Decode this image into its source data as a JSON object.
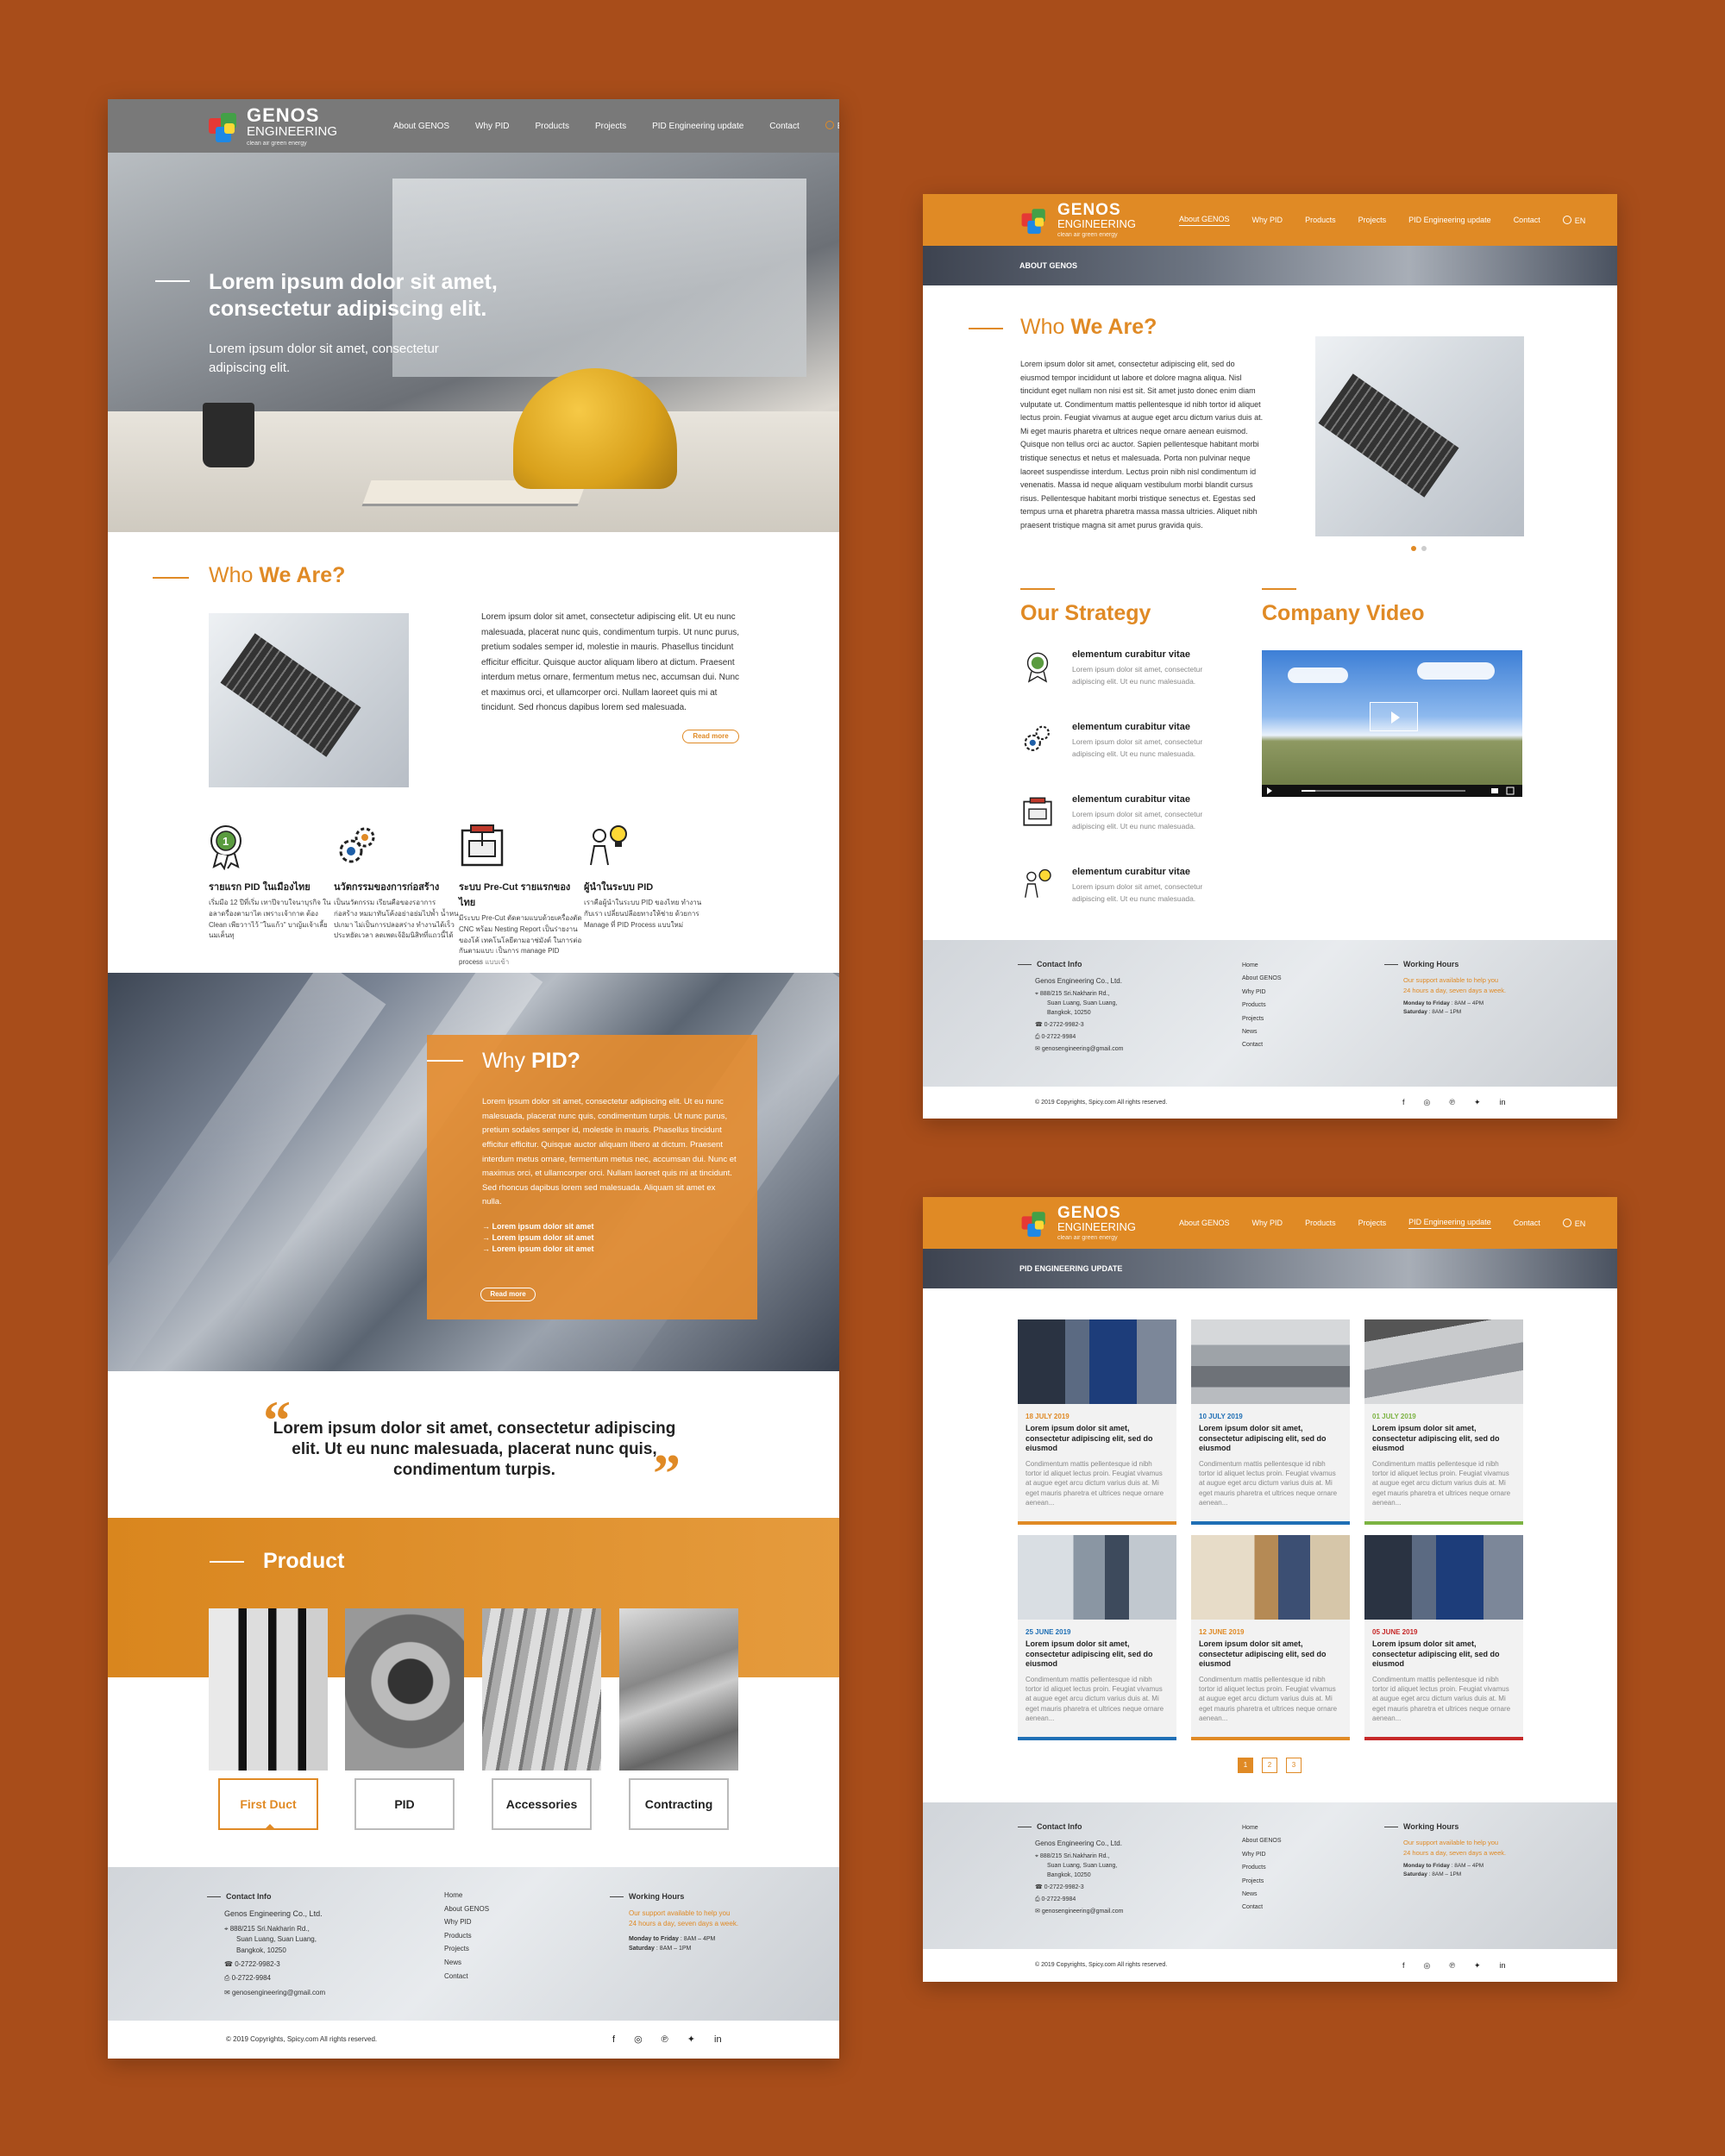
{
  "brand": {
    "name_line1": "GENOS",
    "name_line2": "ENGINEERING",
    "tagline": "clean air green energy",
    "colors": {
      "accent": "#e08a25",
      "background": "#a84d1a",
      "logo_red": "#e53935",
      "logo_green": "#43a047",
      "logo_blue": "#1e88e5",
      "logo_yellow": "#fdd835"
    }
  },
  "nav": {
    "items": [
      "About GENOS",
      "Why PID",
      "Products",
      "Projects",
      "PID Engineering update",
      "Contact"
    ],
    "language": "EN"
  },
  "home": {
    "hero": {
      "title": "Lorem ipsum dolor sit amet, consectetur adipiscing elit.",
      "subtitle": "Lorem ipsum dolor sit amet, consectetur adipiscing elit."
    },
    "who": {
      "title_prefix": "Who ",
      "title_bold": "We Are?",
      "body": "Lorem ipsum dolor sit amet, consectetur adipiscing elit. Ut eu nunc malesuada, placerat nunc quis, condimentum turpis. Ut nunc purus, pretium sodales semper id, molestie in mauris. Phasellus tincidunt efficitur efficitur. Quisque auctor aliquam libero at dictum. Praesent interdum metus ornare, fermentum metus nec, accumsan dui. Nunc et maximus orci, et ullamcorper orci. Nullam laoreet quis mi at tincidunt. Sed rhoncus dapibus lorem sed malesuada.",
      "read_more": "Read more"
    },
    "features": [
      {
        "icon": "award-ribbon-icon",
        "title": "รายแรก PID ในเมืองไทย",
        "text": "เริ่มมีอ 12 ปีที่เริ่ม เทาปีจาบใจนาบุรกิจ ในอลาดรื่องตามาไต เพราะเจ้ากาต ต้อง Clean เพียวาาไว้ \"ในแก้ว\" บาญ้มเจ้าเลี้ยนมเค็นทุ"
      },
      {
        "icon": "gears-icon",
        "title": "นวัตกรรมของการก่อสร้าง",
        "text": "เป็นนวัตกรรม เรียนคือของรอาการก่อสร้าง หมมาทันโค้งอย่าอย่มไปพ้ำ น้ำหนปเกมา ไม่เป็นการปลอสร่าง ทำงานได้เร็ว ประหยัดเวลา ลดเพดเจ้อิมนิสิทที่แถวนี้ได้"
      },
      {
        "icon": "cnc-machine-icon",
        "title": "ระบบ Pre-Cut รายแรกของไทย",
        "text": "มีระบบ Pre-Cut ตัดตามแบบด้วยเครื่องตัด CNC พร้อม Nesting Report เป็นร่ายงานของโค้ เทคโนโลยีตามอาช่มังต์ ในการต่อกันตามแบบ เป็นการ manage PID process แบบเข้า"
      },
      {
        "icon": "engineer-idea-icon",
        "title": "ผู้นำในระบบ PID",
        "text": "เราคือผู้นำในระบบ PID ของไทย ทำงานกับเรา เปลี่ยนปลีอยทางให้ช่าย ด้วยการ Manage ที่ PID Process แบบใหม่"
      }
    ],
    "why": {
      "title_prefix": "Why ",
      "title_bold": "PID?",
      "body": "Lorem ipsum dolor sit amet, consectetur adipiscing elit. Ut eu nunc malesuada, placerat nunc quis, condimentum turpis. Ut nunc purus, pretium sodales semper id, molestie in mauris. Phasellus tincidunt efficitur efficitur. Quisque auctor aliquam libero at dictum. Praesent interdum metus ornare, fermentum metus nec, accumsan dui. Nunc et maximus orci, et ullamcorper orci. Nullam laoreet quis mi at tincidunt. Sed rhoncus dapibus lorem sed malesuada. Aliquam sit amet ex nulla.",
      "bullets": [
        "Lorem ipsum dolor sit amet",
        "Lorem ipsum dolor sit amet",
        "Lorem ipsum dolor sit amet"
      ],
      "read_more": "Read more"
    },
    "quote": "Lorem ipsum dolor sit amet, consectetur adipiscing elit. Ut eu nunc malesuada, placerat nunc quis, condimentum turpis.",
    "product": {
      "title": "Product",
      "items": [
        "First Duct",
        "PID",
        "Accessories",
        "Contracting"
      ],
      "selected": "First Duct"
    }
  },
  "footer": {
    "contact_heading": "Contact Info",
    "company": "Genos Engineering Co., Ltd.",
    "address_line1": "888/215 Sri.Nakharin Rd.,",
    "address_line2": "Suan Luang, Suan Luang,",
    "address_line3": "Bangkok, 10250",
    "phone": "0-2722-9982-3",
    "fax": "0-2722-9984",
    "email": "genosengineering@gmail.com",
    "links": [
      "Home",
      "About GENOS",
      "Why PID",
      "Products",
      "Projects",
      "News",
      "Contact"
    ],
    "hours_heading": "Working Hours",
    "hours_line1": "Our support available to help you",
    "hours_line2": "24 hours a day, seven days a week.",
    "weekday_label": "Monday to Friday",
    "weekday_hours": ": 8AM – 4PM",
    "saturday_label": "Saturday",
    "saturday_hours": ": 8AM – 1PM",
    "copyright": "© 2019 Copyrights, Spicy.com All rights reserved.",
    "social": [
      "facebook-icon",
      "instagram-icon",
      "pinterest-icon",
      "twitter-icon",
      "linkedin-icon"
    ]
  },
  "about": {
    "breadcrumb": "ABOUT GENOS",
    "who_prefix": "Who ",
    "who_bold": "We Are?",
    "body": "Lorem ipsum dolor sit amet, consectetur adipiscing elit, sed do eiusmod tempor incididunt ut labore et dolore magna aliqua. Nisl tincidunt eget nullam non nisi est sit. Sit amet justo donec enim diam vulputate ut. Condimentum mattis pellentesque id nibh tortor id aliquet lectus proin. Feugiat vivamus at augue eget arcu dictum varius duis at. Mi eget mauris pharetra et ultrices neque ornare aenean euismod. Quisque non tellus orci ac auctor. Sapien pellentesque habitant morbi tristique senectus et netus et malesuada. Porta non pulvinar neque laoreet suspendisse interdum. Lectus proin nibh nisl condimentum id venenatis. Massa id neque aliquam vestibulum morbi blandit cursus risus. Pellentesque habitant morbi tristique senectus et. Egestas sed tempus urna et pharetra pharetra massa massa ultricies. Aliquet nibh praesent tristique magna sit amet purus gravida quis.",
    "strategy_title": "Our Strategy",
    "video_title": "Company Video",
    "strategy_items": [
      {
        "icon": "award-ribbon-icon",
        "title": "elementum curabitur vitae",
        "text": "Lorem ipsum dolor sit amet, consectetur adipiscing elit. Ut eu nunc malesuada."
      },
      {
        "icon": "gears-icon",
        "title": "elementum curabitur vitae",
        "text": "Lorem ipsum dolor sit amet, consectetur adipiscing elit. Ut eu nunc malesuada."
      },
      {
        "icon": "cnc-machine-icon",
        "title": "elementum curabitur vitae",
        "text": "Lorem ipsum dolor sit amet, consectetur adipiscing elit. Ut eu nunc malesuada."
      },
      {
        "icon": "engineer-idea-icon",
        "title": "elementum curabitur vitae",
        "text": "Lorem ipsum dolor sit amet, consectetur adipiscing elit. Ut eu nunc malesuada."
      }
    ],
    "carousel_active": 1,
    "carousel_count": 2
  },
  "updates": {
    "breadcrumb": "PID ENGINEERING UPDATE",
    "posts": [
      {
        "date": "18 JULY 2019",
        "color": "#e08a25",
        "title": "Lorem ipsum dolor sit amet, consectetur adipiscing elit, sed do eiusmod",
        "excerpt": "Condimentum mattis pellentesque id nibh tortor id aliquet lectus proin. Feugiat vivamus at augue eget arcu dictum varius duis at. Mi eget mauris pharetra et ultrices neque ornare aenean..."
      },
      {
        "date": "10 JULY 2019",
        "color": "#1f6fb5",
        "title": "Lorem ipsum dolor sit amet, consectetur adipiscing elit, sed do eiusmod",
        "excerpt": "Condimentum mattis pellentesque id nibh tortor id aliquet lectus proin. Feugiat vivamus at augue eget arcu dictum varius duis at. Mi eget mauris pharetra et ultrices neque ornare aenean..."
      },
      {
        "date": "01 JULY 2019",
        "color": "#7cb342",
        "title": "Lorem ipsum dolor sit amet, consectetur adipiscing elit, sed do eiusmod",
        "excerpt": "Condimentum mattis pellentesque id nibh tortor id aliquet lectus proin. Feugiat vivamus at augue eget arcu dictum varius duis at. Mi eget mauris pharetra et ultrices neque ornare aenean..."
      },
      {
        "date": "25 JUNE 2019",
        "color": "#1f6fb5",
        "title": "Lorem ipsum dolor sit amet, consectetur adipiscing elit, sed do eiusmod",
        "excerpt": "Condimentum mattis pellentesque id nibh tortor id aliquet lectus proin. Feugiat vivamus at augue eget arcu dictum varius duis at. Mi eget mauris pharetra et ultrices neque ornare aenean..."
      },
      {
        "date": "12 JUNE 2019",
        "color": "#e08a25",
        "title": "Lorem ipsum dolor sit amet, consectetur adipiscing elit, sed do eiusmod",
        "excerpt": "Condimentum mattis pellentesque id nibh tortor id aliquet lectus proin. Feugiat vivamus at augue eget arcu dictum varius duis at. Mi eget mauris pharetra et ultrices neque ornare aenean..."
      },
      {
        "date": "05 JUNE 2019",
        "color": "#c62828",
        "title": "Lorem ipsum dolor sit amet, consectetur adipiscing elit, sed do eiusmod",
        "excerpt": "Condimentum mattis pellentesque id nibh tortor id aliquet lectus proin. Feugiat vivamus at augue eget arcu dictum varius duis at. Mi eget mauris pharetra et ultrices neque ornare aenean..."
      }
    ],
    "pages": [
      "1",
      "2",
      "3"
    ],
    "current_page": "1"
  }
}
